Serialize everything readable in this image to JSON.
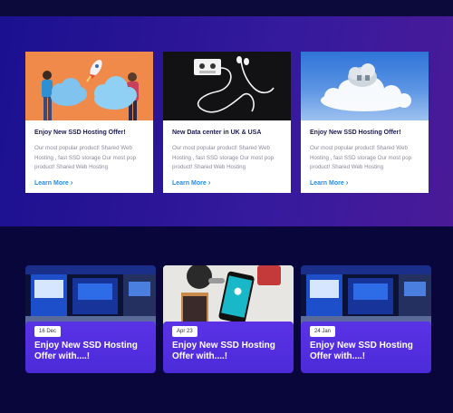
{
  "features": [
    {
      "title": "Enjoy New SSD Hosting Offer!",
      "text": "Our most popular product! Shared Web Hosting , fast SSD storage Our most pop product! Shared Web Hosting",
      "link": "Learn More",
      "image": "people-holding-clouds-rocket"
    },
    {
      "title": "New Data center in UK & USA",
      "text": "Our most popular product! Shared Web Hosting , fast SSD storage Our most pop product! Shared Web Hosting",
      "link": "Learn More",
      "image": "cassette-headphones"
    },
    {
      "title": "Enjoy New SSD Hosting Offer!",
      "text": "Our most popular product! Shared Web Hosting , fast SSD storage Our most pop product! Shared Web Hosting",
      "link": "Learn More",
      "image": "cloud-house"
    }
  ],
  "news": [
    {
      "date": "16 Dec",
      "title": "Enjoy New SSD Hosting Offer with....!",
      "image": "exhibition-stand"
    },
    {
      "date": "Apr 23",
      "title": "Enjoy New SSD Hosting Offer with....!",
      "image": "phone-on-desk"
    },
    {
      "date": "24 Jan",
      "title": "Enjoy New SSD Hosting Offer with....!",
      "image": "exhibition-stand"
    }
  ],
  "colors": {
    "hero_gradient": [
      "#1a1190",
      "#4a1a98"
    ],
    "lower_background": "#08063a",
    "link": "#1d8bf0",
    "news_panel": "#5a32e6"
  }
}
